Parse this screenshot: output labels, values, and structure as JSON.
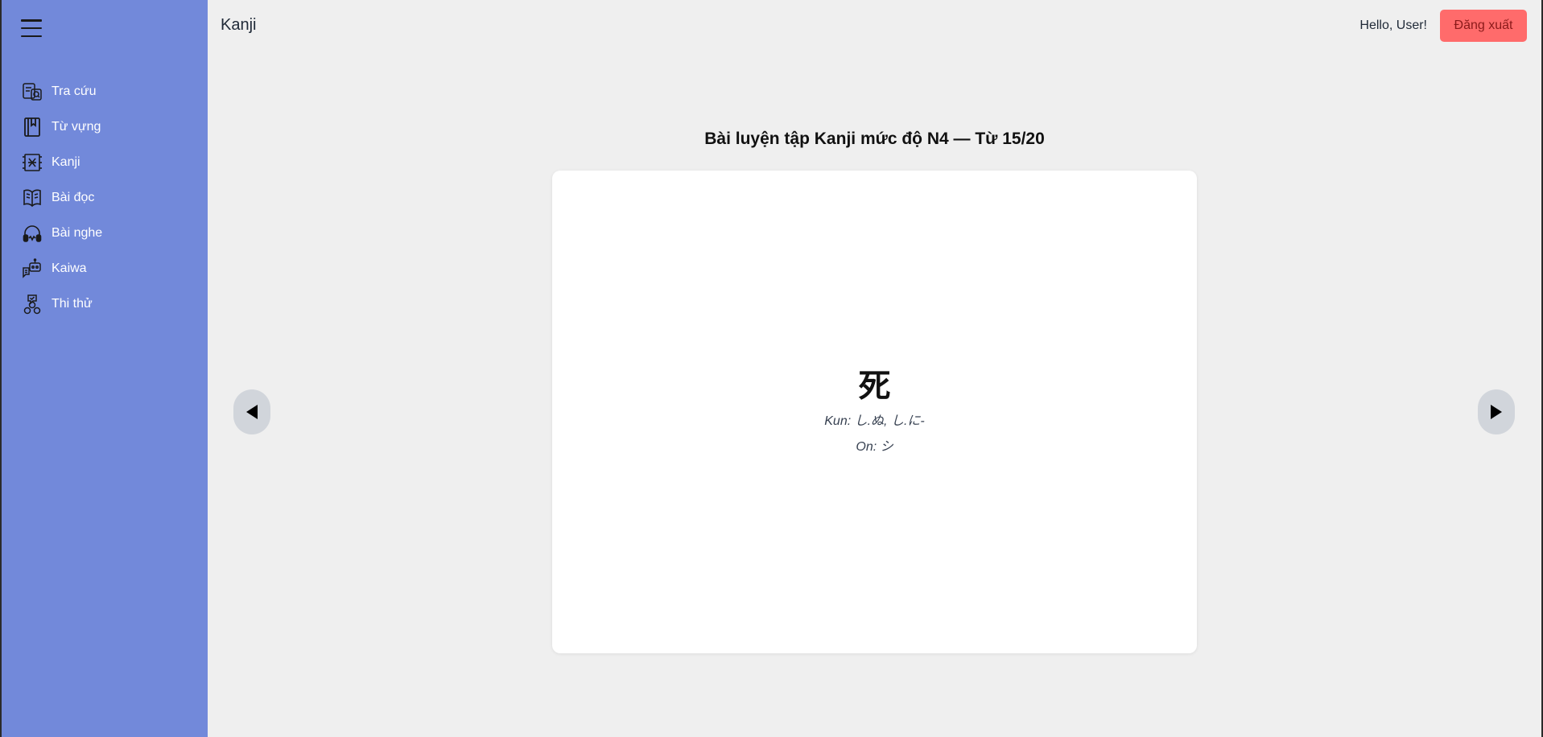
{
  "sidebar": {
    "menu_icon": "hamburger-menu-icon",
    "items": [
      {
        "label": "Tra cứu",
        "icon": "lookup-icon"
      },
      {
        "label": "Từ vựng",
        "icon": "book-icon"
      },
      {
        "label": "Kanji",
        "icon": "kanji-icon"
      },
      {
        "label": "Bài đọc",
        "icon": "open-book-icon"
      },
      {
        "label": "Bài nghe",
        "icon": "headphones-icon"
      },
      {
        "label": "Kaiwa",
        "icon": "robot-chat-icon"
      },
      {
        "label": "Thi thử",
        "icon": "quiz-icon"
      }
    ],
    "background": "#7289da"
  },
  "header": {
    "title": "Kanji",
    "greeting": "Hello, User!",
    "logout_label": "Đăng xuất",
    "logout_color": "#ff6b6b"
  },
  "exercise": {
    "title": "Bài luyện tập Kanji mức độ N4 — Từ 15/20",
    "card": {
      "kanji": "死",
      "kun": "Kun: し.ぬ, し.に-",
      "on": "On: シ"
    },
    "prev_icon": "arrow-left-icon",
    "next_icon": "arrow-right-icon"
  }
}
